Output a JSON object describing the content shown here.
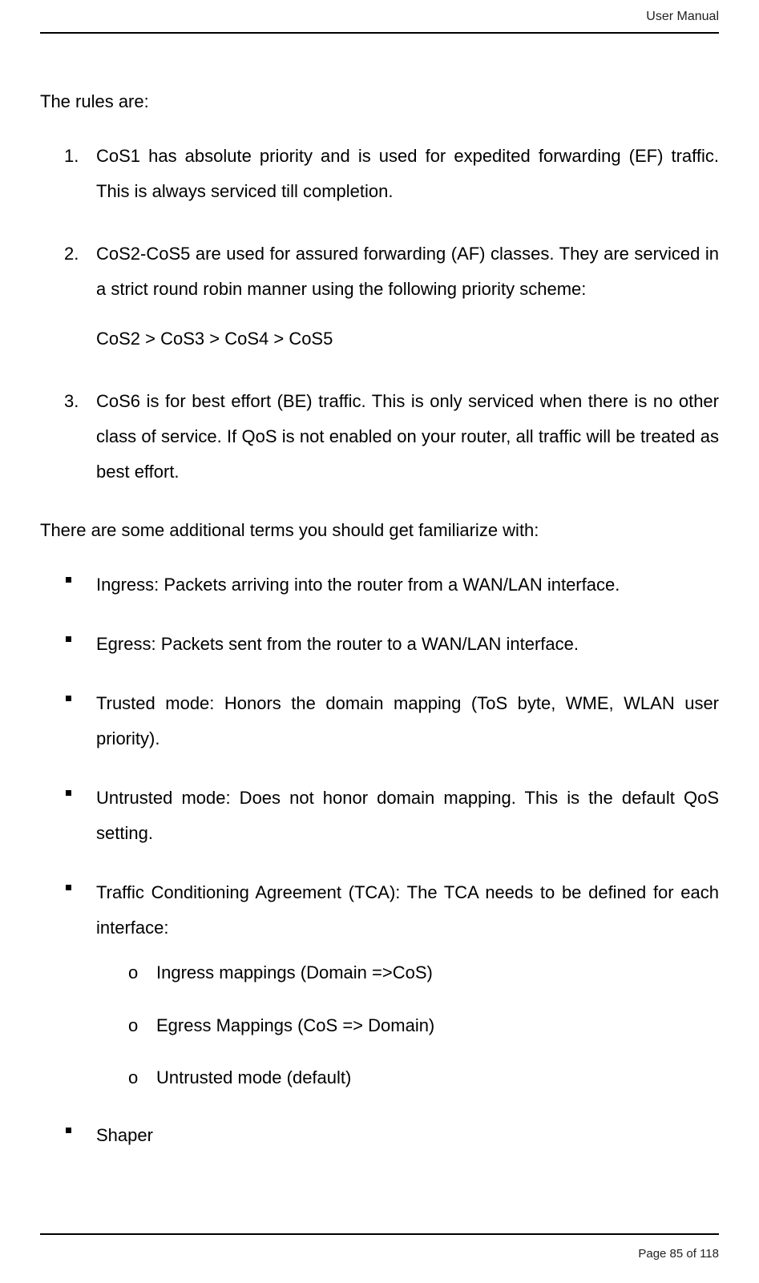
{
  "header": {
    "right": "User Manual"
  },
  "intro": "The rules are:",
  "rules": [
    {
      "num": "1.",
      "text": "CoS1 has absolute priority and is used for expedited forwarding (EF) traffic. This is always serviced till completion."
    },
    {
      "num": "2.",
      "text": "CoS2-CoS5 are used for assured forwarding (AF) classes. They are serviced in a strict round robin manner using the following priority scheme:",
      "sub": "CoS2 > CoS3 > CoS4 > CoS5"
    },
    {
      "num": "3.",
      "text": "CoS6 is for best effort (BE) traffic. This is only serviced when there is no other class of service. If QoS is not enabled on your router, all traffic will be treated as best effort."
    }
  ],
  "terms_intro": "There are some additional terms you should get familiarize with:",
  "terms": [
    {
      "text": "Ingress: Packets arriving into the router from a WAN/LAN interface."
    },
    {
      "text": "Egress: Packets sent from the router to a WAN/LAN interface."
    },
    {
      "text": "Trusted mode: Honors the domain mapping (ToS byte, WME, WLAN user priority)."
    },
    {
      "text": "Untrusted mode: Does not honor domain mapping. This is the default QoS setting."
    },
    {
      "text": "Traffic Conditioning Agreement (TCA): The TCA needs to be defined for each interface:",
      "subs": [
        "Ingress mappings (Domain =>CoS)",
        "Egress Mappings (CoS => Domain)",
        "Untrusted mode (default)"
      ]
    },
    {
      "text": "Shaper"
    }
  ],
  "footer": {
    "page_text": "Page 85 of 118"
  }
}
